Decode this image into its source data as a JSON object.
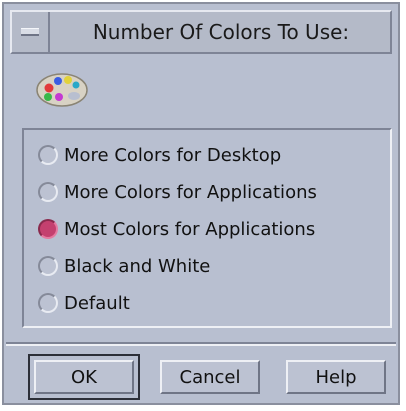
{
  "dialog": {
    "title": "Number Of Colors To Use:",
    "window_menu_icon": "window-menu-icon",
    "palette_icon": "paint-palette-icon"
  },
  "options": [
    {
      "label": "More Colors for Desktop",
      "selected": false
    },
    {
      "label": "More Colors for Applications",
      "selected": false
    },
    {
      "label": "Most Colors for Applications",
      "selected": true
    },
    {
      "label": "Black and White",
      "selected": false
    },
    {
      "label": "Default",
      "selected": false
    }
  ],
  "buttons": {
    "ok": "OK",
    "cancel": "Cancel",
    "help": "Help"
  },
  "colors": {
    "window_bg": "#b8bfd0",
    "selected_radio": "#c4406f"
  }
}
